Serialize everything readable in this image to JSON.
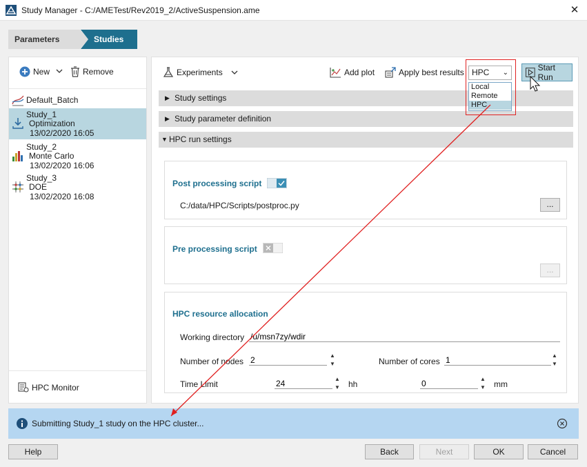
{
  "window": {
    "title": "Study Manager - C:/AMETest/Rev2019_2/ActiveSuspension.ame",
    "close_glyph": "✕"
  },
  "tabs": [
    {
      "label": "Parameters"
    },
    {
      "label": "Studies"
    }
  ],
  "left_toolbar": {
    "new_label": "New",
    "remove_label": "Remove"
  },
  "studies": [
    {
      "name": "Default_Batch",
      "type": "",
      "date": ""
    },
    {
      "name": "Study_1",
      "type": "Optimization",
      "date": "13/02/2020 16:05"
    },
    {
      "name": "Study_2",
      "type": "Monte Carlo",
      "date": "13/02/2020 16:06"
    },
    {
      "name": "Study_3",
      "type": "DOE",
      "date": "13/02/2020 16:08"
    }
  ],
  "hpc_monitor_label": "HPC Monitor",
  "right_toolbar": {
    "experiments_label": "Experiments",
    "add_plot_label": "Add plot",
    "apply_best_label": "Apply best results",
    "start_run_label": "Start Run"
  },
  "run_target": {
    "selected": "HPC",
    "options": [
      "Local",
      "Remote",
      "HPC"
    ]
  },
  "sections": {
    "study_settings": "Study settings",
    "param_def": "Study parameter definition",
    "hpc_run": "HPC run settings"
  },
  "post_processing": {
    "title": "Post processing script",
    "path": "C:/data/HPC/Scripts/postproc.py",
    "enabled": true
  },
  "pre_processing": {
    "title": "Pre processing script",
    "enabled": false
  },
  "ellipsis_label": "...",
  "hpc_resources": {
    "title": "HPC resource allocation",
    "working_dir_label": "Working directory",
    "working_dir": "/u/msn7zy/wdir",
    "nodes_label": "Number of nodes",
    "nodes": "2",
    "cores_label": "Number of cores",
    "cores": "1",
    "time_limit_label": "Time Limit",
    "hours": "24",
    "hours_unit": "hh",
    "minutes": "0",
    "minutes_unit": "mm"
  },
  "info": {
    "message": "Submitting Study_1 study on the HPC cluster..."
  },
  "buttons": {
    "help": "Help",
    "back": "Back",
    "next": "Next",
    "ok": "OK",
    "cancel": "Cancel"
  },
  "colors": {
    "accent": "#1e6f8e",
    "selection": "#b8d6e0",
    "info_bar": "#b5d6f1",
    "annotation": "#e02020"
  }
}
